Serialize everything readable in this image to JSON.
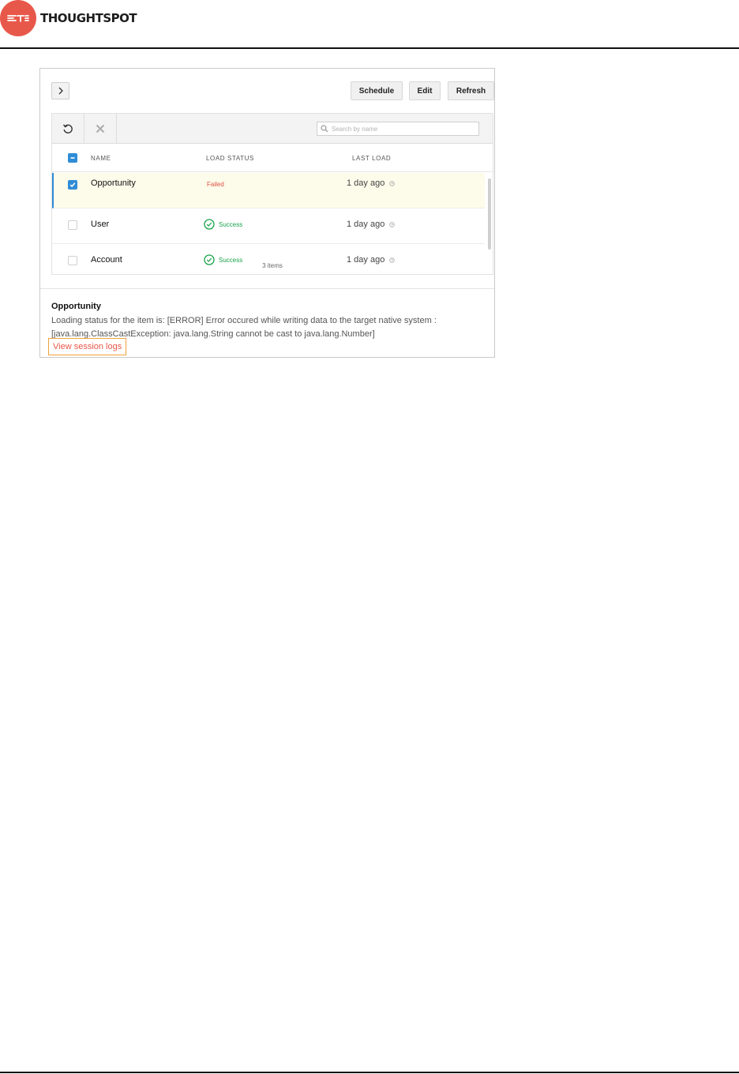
{
  "brand": {
    "name": "THOUGHTSPOT",
    "accent": "#e8584a"
  },
  "toolbar": {
    "expand_icon": "chevron-right-icon",
    "schedule_label": "Schedule",
    "edit_label": "Edit",
    "refresh_label": "Refresh",
    "reload_icon": "reload-icon",
    "delete_icon": "close-icon",
    "search_placeholder": "Search by name"
  },
  "table": {
    "columns": [
      "NAME",
      "LOAD STATUS",
      "LAST LOAD"
    ],
    "rows": [
      {
        "name": "Opportunity",
        "status": "Failed",
        "last_load": "1 day ago",
        "checked": true,
        "selected": true
      },
      {
        "name": "User",
        "status": "Success",
        "last_load": "1 day ago",
        "checked": false,
        "selected": false
      },
      {
        "name": "Account",
        "status": "Success",
        "last_load": "1 day ago",
        "checked": false,
        "selected": false
      }
    ],
    "count_label": "3 items"
  },
  "detail": {
    "title": "Opportunity",
    "message": "Loading status for the item is: [ERROR] Error occured while writing data to the target native system : [java.lang.ClassCastException: java.lang.String cannot be cast to java.lang.Number]",
    "link_label": "View session logs"
  },
  "colors": {
    "failed": "#e05244",
    "success": "#19a24a",
    "selection": "#2f8cd6",
    "highlight": "#f2a33a"
  }
}
